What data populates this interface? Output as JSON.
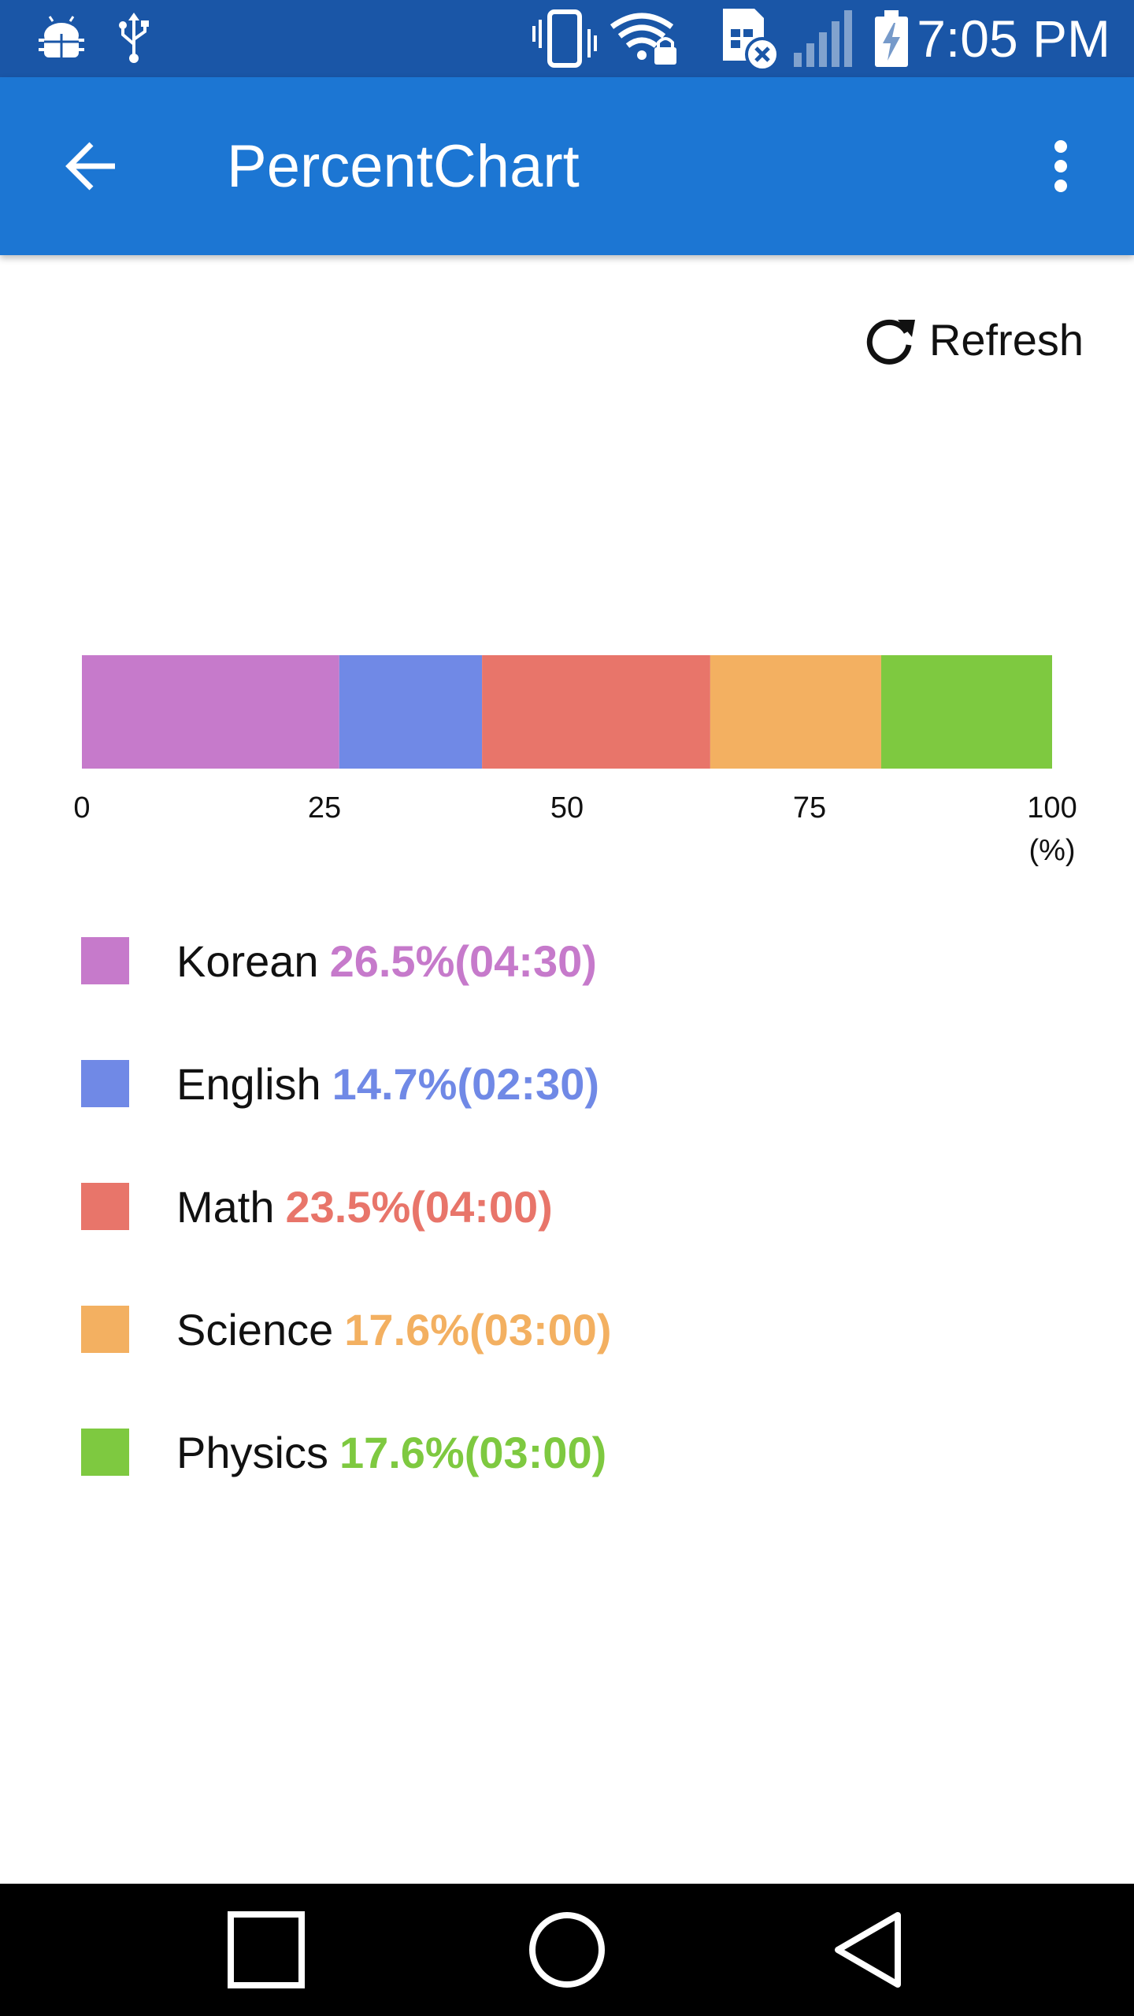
{
  "status_bar": {
    "time": "7:05 PM",
    "icons": [
      "android-debug-icon",
      "usb-icon",
      "vibrate-icon",
      "wifi-lock-icon",
      "no-sim-icon",
      "signal-icon",
      "battery-charging-icon"
    ]
  },
  "app_bar": {
    "title": "PercentChart",
    "back_icon": "arrow-back-icon",
    "menu_icon": "more-vert-icon",
    "color": "#1c76d3"
  },
  "refresh": {
    "label": "Refresh",
    "icon": "refresh-icon"
  },
  "chart_data": {
    "type": "bar",
    "orientation": "horizontal-stacked-percent",
    "categories": [
      "Korean",
      "English",
      "Math",
      "Science",
      "Physics"
    ],
    "values": [
      26.5,
      14.7,
      23.5,
      17.6,
      17.6
    ],
    "colors": [
      "#c67acb",
      "#7089e6",
      "#e8756a",
      "#f3b061",
      "#7ec940"
    ],
    "xlim": [
      0,
      100
    ],
    "x_ticks": [
      "0",
      "25",
      "50",
      "75",
      "100"
    ],
    "x_unit": "(%)",
    "grid": false
  },
  "legend": {
    "items": [
      {
        "label": "Korean",
        "value": "26.5%(04:30)",
        "color": "#c67acb"
      },
      {
        "label": "English",
        "value": "14.7%(02:30)",
        "color": "#7089e6"
      },
      {
        "label": "Math",
        "value": "23.5%(04:00)",
        "color": "#e8756a"
      },
      {
        "label": "Science",
        "value": "17.6%(03:00)",
        "color": "#f3b061"
      },
      {
        "label": "Physics",
        "value": "17.6%(03:00)",
        "color": "#7ec940"
      }
    ]
  },
  "nav_bar": {
    "icons": [
      "recents-square-icon",
      "home-circle-icon",
      "back-triangle-icon"
    ]
  }
}
